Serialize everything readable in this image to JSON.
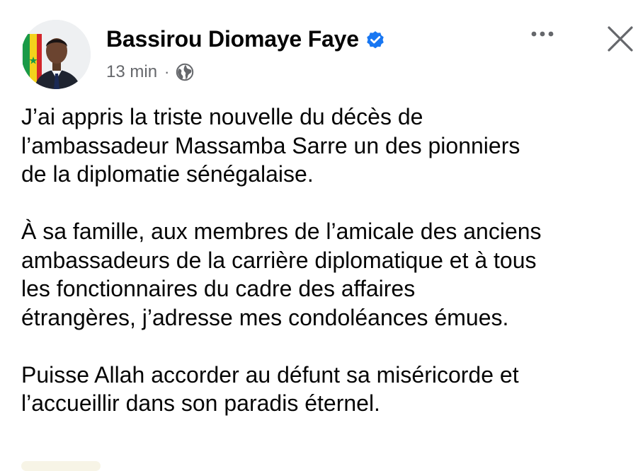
{
  "post": {
    "author": {
      "name": "Bassirou Diomaye Faye",
      "verified": true,
      "avatar_icon": "profile-photo"
    },
    "meta": {
      "time": "13 min",
      "separator": "·",
      "audience_icon": "globe-icon"
    },
    "actions": {
      "more_icon": "more-options-icon",
      "close_icon": "close-icon"
    },
    "body": {
      "paragraphs": [
        "J’ai appris la triste nouvelle du décès de\nl’ambassadeur Massamba Sarre un des pionniers\nde la diplomatie sénégalaise.",
        "À sa famille, aux membres de l’amicale des anciens\nambassadeurs de la carrière diplomatique et à tous\nles fonctionnaires du cadre des affaires\nétrangères, j’adresse mes condoléances émues.",
        "Puisse Allah accorder au défunt sa miséricorde et\nl’accueillir dans son paradis éternel."
      ]
    }
  },
  "colors": {
    "text": "#050505",
    "secondary_text": "#65676b",
    "verified_blue": "#1877f2",
    "background": "#ffffff"
  }
}
